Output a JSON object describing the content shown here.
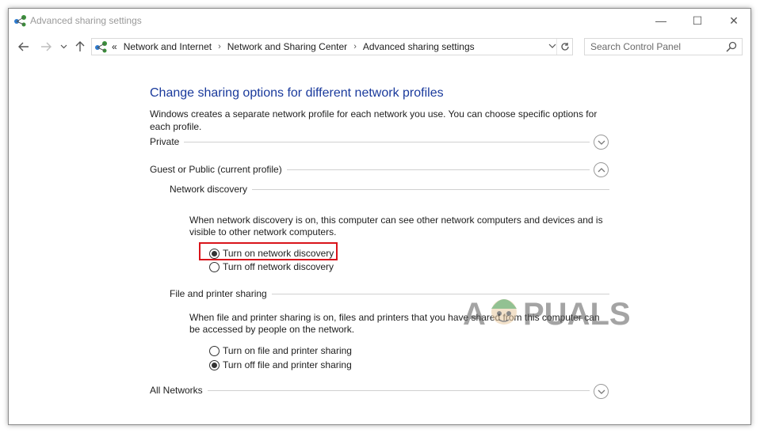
{
  "window": {
    "title": "Advanced sharing settings",
    "controls": {
      "minimize": "—",
      "maximize": "☐",
      "close": "✕"
    }
  },
  "nav": {
    "back_icon": "back-arrow-icon",
    "forward_icon": "forward-arrow-icon",
    "recent_icon": "chevron-down-icon",
    "up_icon": "up-arrow-icon"
  },
  "address": {
    "overflow": "«",
    "crumbs": [
      "Network and Internet",
      "Network and Sharing Center",
      "Advanced sharing settings"
    ],
    "separator": "›"
  },
  "search": {
    "placeholder": "Search Control Panel"
  },
  "main": {
    "heading": "Change sharing options for different network profiles",
    "description": "Windows creates a separate network profile for each network you use. You can choose specific options for each profile.",
    "profiles": [
      {
        "label": "Private",
        "expanded": false
      },
      {
        "label": "Guest or Public (current profile)",
        "expanded": true
      },
      {
        "label": "All Networks",
        "expanded": false
      }
    ],
    "network_discovery": {
      "label": "Network discovery",
      "text": "When network discovery is on, this computer can see other network computers and devices and is visible to other network computers.",
      "options": [
        {
          "label": "Turn on network discovery",
          "checked": true
        },
        {
          "label": "Turn off network discovery",
          "checked": false
        }
      ]
    },
    "file_sharing": {
      "label": "File and printer sharing",
      "text": "When file and printer sharing is on, files and printers that you have shared from this computer can be accessed by people on the network.",
      "options": [
        {
          "label": "Turn on file and printer sharing",
          "checked": false
        },
        {
          "label": "Turn off file and printer sharing",
          "checked": true
        }
      ]
    }
  },
  "watermark": {
    "text": "APPUALS"
  },
  "colors": {
    "heading": "#1a3a9c",
    "highlight": "#d9141b",
    "accent_green": "#3a8f3a"
  }
}
